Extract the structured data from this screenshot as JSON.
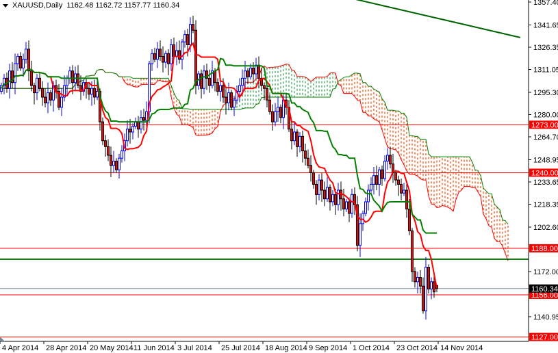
{
  "header": {
    "symbol": "XAUUSD,Daily",
    "ohlc": "1162.48 1162.72 1157.77 1160.34"
  },
  "colors": {
    "bull": "#0000ff",
    "bear_body": "#ff0000",
    "tenkan": "#ff0000",
    "kijun": "#008000",
    "cloud_bull": "#2ea44f",
    "cloud_bear": "#ff4500",
    "level": "#ff0000",
    "trendline": "#006400",
    "current_price": "#778899"
  },
  "chart_data": {
    "type": "candlestick",
    "title": "XAUUSD,Daily",
    "indicator": "Ichimoku Kinko Hyo",
    "ylim": [
      1127,
      1357.4
    ],
    "y_ticks": [
      "1357.40",
      "1341.65",
      "1326.35",
      "1311.05",
      "1295.30",
      "1280.00",
      "1264.70",
      "1248.95",
      "1233.65",
      "1218.35",
      "1202.60",
      "1172.00",
      "1140.95"
    ],
    "x_ticks": [
      "4 Apr 2014",
      "28 Apr 2014",
      "20 May 2014",
      "11 Jun 2014",
      "3 Jul 2014",
      "25 Jul 2014",
      "18 Aug 2014",
      "9 Sep 2014",
      "1 Oct 2014",
      "23 Oct 2014",
      "14 Nov 2014"
    ],
    "bars_per_x_tick": 16,
    "closes": [
      1300,
      1305,
      1298,
      1310,
      1302,
      1315,
      1320,
      1312,
      1318,
      1325,
      1310,
      1300,
      1295,
      1305,
      1298,
      1292,
      1288,
      1295,
      1290,
      1300,
      1296,
      1285,
      1292,
      1300,
      1305,
      1310,
      1302,
      1308,
      1300,
      1296,
      1302,
      1298,
      1294,
      1298,
      1292,
      1296,
      1275,
      1262,
      1258,
      1252,
      1245,
      1248,
      1242,
      1250,
      1255,
      1262,
      1270,
      1268,
      1272,
      1275,
      1270,
      1278,
      1276,
      1282,
      1315,
      1322,
      1318,
      1325,
      1320,
      1316,
      1322,
      1315,
      1328,
      1320,
      1324,
      1318,
      1330,
      1335,
      1328,
      1342,
      1338,
      1300,
      1308,
      1298,
      1310,
      1305,
      1300,
      1310,
      1302,
      1296,
      1300,
      1292,
      1288,
      1295,
      1285,
      1290,
      1296,
      1300,
      1305,
      1310,
      1306,
      1312,
      1308,
      1314,
      1305,
      1300,
      1298,
      1290,
      1282,
      1275,
      1282,
      1285,
      1278,
      1290,
      1285,
      1270,
      1262,
      1268,
      1258,
      1265,
      1255,
      1250,
      1245,
      1240,
      1232,
      1225,
      1235,
      1228,
      1222,
      1230,
      1220,
      1225,
      1218,
      1228,
      1222,
      1215,
      1220,
      1212,
      1225,
      1218,
      1190,
      1205,
      1212,
      1220,
      1228,
      1232,
      1238,
      1232,
      1242,
      1236,
      1248,
      1252,
      1246,
      1240,
      1235,
      1232,
      1226,
      1228,
      1215,
      1200,
      1172,
      1165,
      1168,
      1162,
      1145,
      1175,
      1160,
      1165,
      1158,
      1160.34
    ],
    "last_bar": {
      "open": 1162.48,
      "high": 1162.72,
      "low": 1157.77,
      "close": 1160.34
    },
    "levels": [
      {
        "price": 1273.0,
        "label": "1273.00",
        "color": "#ff0000"
      },
      {
        "price": 1240.0,
        "label": "1240.00",
        "color": "#ff0000"
      },
      {
        "price": 1188.0,
        "label": "1188.00",
        "color": "#ff0000"
      },
      {
        "price": 1156.0,
        "label": "1156.00",
        "color": "#ff0000"
      },
      {
        "price": 1127.0,
        "label": "1127.00",
        "color": "#ff0000"
      }
    ],
    "support_line": {
      "price": 1180.5
    },
    "current_price": {
      "price": 1160.34,
      "label": "1160.34"
    },
    "trendline": {
      "from_price": 1372,
      "to_price": 1333
    }
  }
}
